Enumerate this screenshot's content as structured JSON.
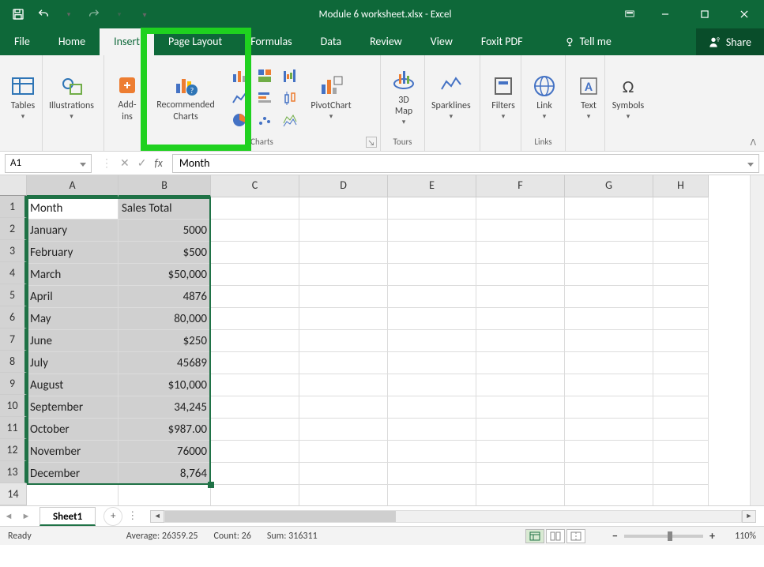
{
  "title": "Module 6 worksheet.xlsx - Excel",
  "ribbon_tabs": [
    "File",
    "Home",
    "Insert",
    "Page Layout",
    "Formulas",
    "Data",
    "Review",
    "View",
    "Foxit PDF"
  ],
  "active_tab_index": 2,
  "tellme": "Tell me",
  "share": "Share",
  "groups": {
    "tables": "Tables",
    "illustrations": "Illustrations",
    "addins": "Add-\nins",
    "recommended": "Recommended\nCharts",
    "charts_lbl": "Charts",
    "pivotchart": "PivotChart",
    "tours_lbl": "Tours",
    "map": "3D\nMap",
    "sparklines": "Sparklines",
    "filters": "Filters",
    "links_lbl": "Links",
    "link": "Link",
    "text": "Text",
    "symbols": "Symbols"
  },
  "name_box": "A1",
  "formula_value": "Month",
  "columns": [
    "A",
    "B",
    "C",
    "D",
    "E",
    "F",
    "G",
    "H"
  ],
  "data": [
    [
      "Month",
      "Sales Total"
    ],
    [
      "January",
      "5000"
    ],
    [
      "February",
      "$500"
    ],
    [
      "March",
      "$50,000"
    ],
    [
      "April",
      "4876"
    ],
    [
      "May",
      "80,000"
    ],
    [
      "June",
      "$250"
    ],
    [
      "July",
      "45689"
    ],
    [
      "August",
      "$10,000"
    ],
    [
      "September",
      "34,245"
    ],
    [
      "October",
      "$987.00"
    ],
    [
      "November",
      "76000"
    ],
    [
      "December",
      "8,764"
    ]
  ],
  "sheet_name": "Sheet1",
  "status": {
    "ready": "Ready",
    "avg": "Average: 26359.25",
    "count": "Count: 26",
    "sum": "Sum: 316311",
    "zoom": "110%"
  }
}
